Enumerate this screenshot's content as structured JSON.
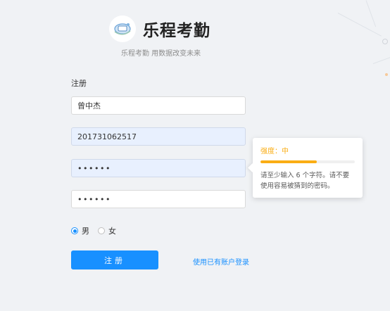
{
  "brand": {
    "title": "乐程考勤",
    "subtitle": "乐程考勤 用数据改变未来",
    "logo_icon": "attendance-logo-icon"
  },
  "form": {
    "section_label": "注册",
    "name_value": "曾中杰",
    "student_id_value": "201731062517",
    "password_mask": "••••••",
    "confirm_mask": "••••••",
    "gender": {
      "male": "男",
      "female": "女",
      "selected": "male"
    },
    "submit_label": "注册",
    "login_link": "使用已有账户登录"
  },
  "password_tooltip": {
    "strength_text": "强度：中",
    "strength_level": 0.6,
    "hint": "请至少输入 6 个字符。请不要使用容易被猜到的密码。"
  },
  "colors": {
    "accent": "#1890ff",
    "warning": "#faad14",
    "background": "#f0f2f5"
  }
}
